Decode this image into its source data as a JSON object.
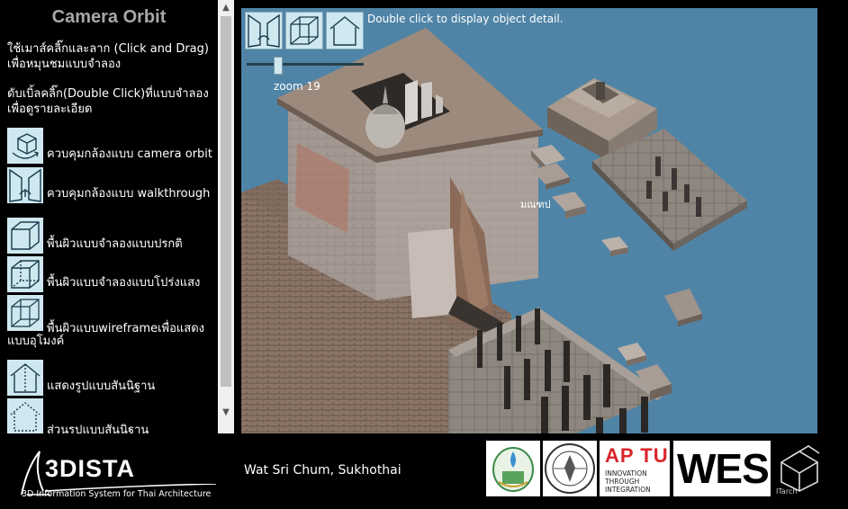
{
  "left_panel": {
    "title": "Camera Orbit",
    "instruction_drag": "ใช้เมาส์คลิ๊กและลาก (Click and Drag) เพื่อหมุนชมแบบจำลอง",
    "instruction_dblclick": "ดับเบิ้ลคลิ๊ก(Double Click)ที่แบบจำลอง เพื่อดูรายละเอียด",
    "menu": {
      "camera_orbit": "ควบคุมกล้องแบบ camera orbit",
      "walkthrough": "ควบคุมกล้องแบบ walkthrough",
      "solid": "พื้นผิวแบบจำลองแบบปรกติ",
      "transparent": "พื้นผิวแบบจำลองแบบโปร่งแสง",
      "wireframe_line1": "พื้นผิวแบบwireframeเพื่อแสดง",
      "wireframe_line2": "แบบอุโมงค์",
      "assumed_form": "แสดงรูปแบบสันนิฐาน",
      "partial_assumed": "ส่วนรูปแบบสันนิฐาน"
    }
  },
  "viewport": {
    "hint": "Double click to display object detail.",
    "zoom_label": "zoom 19",
    "zoom_value": 19,
    "object_label": "มณฑป",
    "background_color": "#4f84a6"
  },
  "footer": {
    "brand_name": "3DISTA",
    "brand_subtitle": "3D Information System for Thai Architecture",
    "site_name": "Wat Sri Chum, Sukhothai",
    "aptu_title": "AP TU",
    "aptu_line1": "INNOVATION",
    "aptu_line2": "THROUGH",
    "aptu_line3": "INTEGRATION",
    "wes": "WES",
    "itarch": "ITarch"
  },
  "colors": {
    "icon_bg": "#cfe8f0",
    "aptu_red": "#d9262b"
  },
  "icons": [
    "orbit-cube-icon",
    "walkthrough-icon",
    "solid-cube-icon",
    "transparent-cube-icon",
    "wireframe-cube-icon",
    "house-icon",
    "partial-house-icon"
  ]
}
